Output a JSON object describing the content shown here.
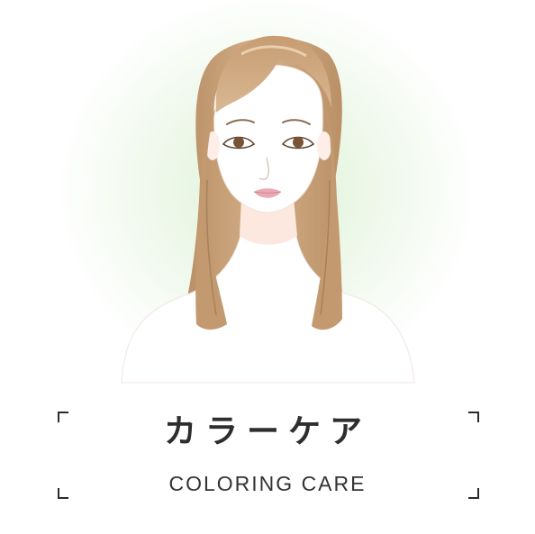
{
  "heading": {
    "japanese": "カラーケア",
    "english": "COLORING CARE"
  },
  "illustration": {
    "subject": "woman-with-long-straight-hair"
  },
  "colors": {
    "background_glow": "#dff3d6",
    "hair": "#c8a27a",
    "text": "#2e2e2e"
  }
}
